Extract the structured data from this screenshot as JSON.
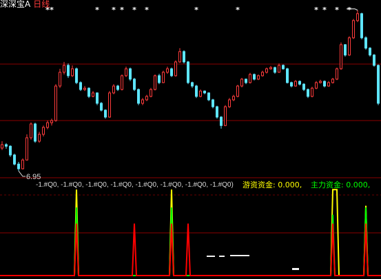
{
  "header": {
    "stock_name": "深深宝A",
    "period": "日线"
  },
  "price_panel": {
    "low_label": "6.95",
    "signal_marker": "*"
  },
  "indicator_panel": {
    "params_text": "-1.#Q0, -1.#Q0, -1.#Q0, -1.#Q0, -1.#Q0, -1.#Q0, -1.#Q0, -1.#Q0)",
    "hot_money_label": "游资资金: 0.000,",
    "main_force_label": "主力资金: 0.000,"
  },
  "colors": {
    "background": "#000000",
    "up_candle": "#ff3c3c",
    "down_candle": "#5ee6ff",
    "grid": "#8b0000",
    "marker": "#ffffff",
    "hot_money": "#ffff00",
    "main_force": "#00ff00",
    "third_series": "#ff0000"
  },
  "chart_data": [
    {
      "type": "bar",
      "mark": "candlestick",
      "title": "",
      "xlabel": "",
      "ylabel": "",
      "ylim": [
        6.91,
        12.12
      ],
      "grid": true,
      "ohlc": [
        [
          7.68,
          7.9,
          7.62,
          7.79
        ],
        [
          7.79,
          7.84,
          7.66,
          7.74
        ],
        [
          7.74,
          7.77,
          7.4,
          7.46
        ],
        [
          7.46,
          7.5,
          7.13,
          7.17
        ],
        [
          7.17,
          7.24,
          6.95,
          7.02
        ],
        [
          7.02,
          7.35,
          7.0,
          7.3
        ],
        [
          7.3,
          8.12,
          7.28,
          8.01
        ],
        [
          8.01,
          8.5,
          7.95,
          8.45
        ],
        [
          8.45,
          8.49,
          7.85,
          7.9
        ],
        [
          7.9,
          8.2,
          7.85,
          8.12
        ],
        [
          8.12,
          8.4,
          8.05,
          8.34
        ],
        [
          8.34,
          8.56,
          8.28,
          8.49
        ],
        [
          8.49,
          8.62,
          8.4,
          8.56
        ],
        [
          8.56,
          9.72,
          8.52,
          9.66
        ],
        [
          9.66,
          10.21,
          9.6,
          10.1
        ],
        [
          10.1,
          10.43,
          10.03,
          10.32
        ],
        [
          10.32,
          10.38,
          9.92,
          9.99
        ],
        [
          9.99,
          10.32,
          9.95,
          10.21
        ],
        [
          10.21,
          10.25,
          9.72,
          9.77
        ],
        [
          9.77,
          9.81,
          9.5,
          9.55
        ],
        [
          9.55,
          9.66,
          9.5,
          9.59
        ],
        [
          9.59,
          9.62,
          9.28,
          9.33
        ],
        [
          9.33,
          9.5,
          9.3,
          9.44
        ],
        [
          9.44,
          9.46,
          9.05,
          9.11
        ],
        [
          9.11,
          9.15,
          8.85,
          8.89
        ],
        [
          8.89,
          8.92,
          8.62,
          8.67
        ],
        [
          8.67,
          9.5,
          8.65,
          9.44
        ],
        [
          9.44,
          9.72,
          9.4,
          9.66
        ],
        [
          9.66,
          9.7,
          9.5,
          9.55
        ],
        [
          9.55,
          10.03,
          9.52,
          9.99
        ],
        [
          9.99,
          10.28,
          9.95,
          10.21
        ],
        [
          10.21,
          10.25,
          9.82,
          9.88
        ],
        [
          9.88,
          9.92,
          9.5,
          9.55
        ],
        [
          9.55,
          9.58,
          9.05,
          9.11
        ],
        [
          9.11,
          9.28,
          9.05,
          9.22
        ],
        [
          9.22,
          9.38,
          9.18,
          9.33
        ],
        [
          9.33,
          9.6,
          9.3,
          9.55
        ],
        [
          9.55,
          10.03,
          9.52,
          9.99
        ],
        [
          9.99,
          10.05,
          9.72,
          9.77
        ],
        [
          9.77,
          10.15,
          9.75,
          10.1
        ],
        [
          10.1,
          10.28,
          10.05,
          10.21
        ],
        [
          10.21,
          10.25,
          9.95,
          9.99
        ],
        [
          9.99,
          10.48,
          9.96,
          10.43
        ],
        [
          10.43,
          10.87,
          10.4,
          10.76
        ],
        [
          10.76,
          10.8,
          10.38,
          10.43
        ],
        [
          10.43,
          10.46,
          9.72,
          9.77
        ],
        [
          9.77,
          9.8,
          9.6,
          9.66
        ],
        [
          9.66,
          9.7,
          9.28,
          9.33
        ],
        [
          9.33,
          9.55,
          9.3,
          9.5
        ],
        [
          9.5,
          9.52,
          9.4,
          9.44
        ],
        [
          9.44,
          9.46,
          9.18,
          9.22
        ],
        [
          9.22,
          9.25,
          8.95,
          9.0
        ],
        [
          9.0,
          9.03,
          8.62,
          8.67
        ],
        [
          8.67,
          8.7,
          8.3,
          8.4
        ],
        [
          8.4,
          9.05,
          8.38,
          9.0
        ],
        [
          9.0,
          9.28,
          8.96,
          9.22
        ],
        [
          9.22,
          9.38,
          9.18,
          9.33
        ],
        [
          9.33,
          9.7,
          9.3,
          9.66
        ],
        [
          9.66,
          9.92,
          9.62,
          9.88
        ],
        [
          9.88,
          9.9,
          9.72,
          9.77
        ],
        [
          9.77,
          10.08,
          9.74,
          10.03
        ],
        [
          10.03,
          10.06,
          9.84,
          9.88
        ],
        [
          9.88,
          10.03,
          9.85,
          9.99
        ],
        [
          9.99,
          10.15,
          9.96,
          10.1
        ],
        [
          10.1,
          10.25,
          10.06,
          10.21
        ],
        [
          10.21,
          10.3,
          10.18,
          10.25
        ],
        [
          10.25,
          10.28,
          10.05,
          10.1
        ],
        [
          10.1,
          10.38,
          10.08,
          10.32
        ],
        [
          10.32,
          10.35,
          10.18,
          10.21
        ],
        [
          10.21,
          10.24,
          9.74,
          9.77
        ],
        [
          9.77,
          9.8,
          9.62,
          9.66
        ],
        [
          9.66,
          9.85,
          9.64,
          9.81
        ],
        [
          9.81,
          9.84,
          9.68,
          9.72
        ],
        [
          9.72,
          9.75,
          9.5,
          9.55
        ],
        [
          9.55,
          9.58,
          9.28,
          9.33
        ],
        [
          9.33,
          9.64,
          9.3,
          9.59
        ],
        [
          9.59,
          9.82,
          9.56,
          9.77
        ],
        [
          9.77,
          9.86,
          9.74,
          9.81
        ],
        [
          9.81,
          9.84,
          9.62,
          9.66
        ],
        [
          9.66,
          9.82,
          9.64,
          9.77
        ],
        [
          9.77,
          9.92,
          9.74,
          9.88
        ],
        [
          9.88,
          10.25,
          9.85,
          10.21
        ],
        [
          10.21,
          11.05,
          10.18,
          10.98
        ],
        [
          10.98,
          11.0,
          10.6,
          10.65
        ],
        [
          10.65,
          11.25,
          10.62,
          11.2
        ],
        [
          11.2,
          11.8,
          11.16,
          11.75
        ],
        [
          11.75,
          12.08,
          11.7,
          11.97
        ],
        [
          11.97,
          12.0,
          11.15,
          11.2
        ],
        [
          11.2,
          11.25,
          10.82,
          10.87
        ],
        [
          10.87,
          10.9,
          10.6,
          10.65
        ],
        [
          10.65,
          10.68,
          10.28,
          10.32
        ],
        [
          10.32,
          10.35,
          9.05,
          9.11
        ]
      ],
      "signal_bars": [
        11,
        12,
        23,
        27,
        29,
        32,
        35,
        47,
        57,
        76,
        78,
        81,
        84
      ]
    },
    {
      "type": "line",
      "title": "",
      "ylim": [
        0,
        5
      ],
      "grid": true,
      "series": [
        {
          "name": "游资资金",
          "color": "#ffff00",
          "values": [
            0,
            0,
            0,
            0,
            0,
            0,
            0,
            0,
            0,
            0,
            0,
            0,
            0,
            0,
            0,
            0,
            0,
            0,
            4.8,
            0,
            0,
            0,
            0,
            0,
            0,
            0,
            0,
            0,
            0,
            0,
            0,
            0,
            0,
            0,
            0,
            0,
            0,
            0,
            0,
            0,
            0,
            4.8,
            0,
            0,
            0,
            0,
            0,
            0,
            0,
            0,
            0,
            0,
            0,
            0,
            0,
            0,
            0,
            0,
            0,
            0,
            0,
            0,
            0,
            0,
            0,
            0,
            0,
            0,
            0,
            0,
            0,
            0,
            0,
            0,
            0,
            0,
            0,
            0,
            0,
            0,
            4.8,
            4.8,
            0,
            0,
            0,
            0,
            0,
            0,
            3.9,
            0,
            0,
            0
          ]
        },
        {
          "name": "主力资金",
          "color": "#00ff00",
          "values": [
            0,
            0,
            0,
            0,
            0,
            0,
            0,
            0,
            0,
            0,
            0,
            0,
            0,
            0,
            0,
            0,
            0,
            0,
            3.8,
            0,
            0,
            0,
            0,
            0,
            0,
            0,
            0,
            0,
            0,
            0,
            0,
            0,
            0,
            0,
            0,
            0,
            0,
            0,
            0,
            0,
            0,
            3.8,
            0,
            0,
            0,
            0,
            0,
            0,
            0,
            0,
            0,
            0,
            0,
            0,
            0,
            0,
            0,
            0,
            0,
            0,
            0,
            0,
            0,
            0,
            0,
            0,
            0,
            0,
            0,
            0,
            0,
            0,
            0,
            0,
            0,
            0,
            0,
            0,
            0,
            0,
            3.4,
            0,
            0,
            0,
            0,
            0,
            0,
            0,
            3.8,
            0,
            0,
            0
          ]
        },
        {
          "color": "#ff0000",
          "values": [
            0,
            0,
            0,
            0,
            0,
            0,
            0,
            0,
            0,
            0,
            0,
            0,
            0,
            0,
            0,
            0,
            0,
            0,
            2.9,
            0,
            0,
            0,
            0,
            0,
            0,
            0,
            0,
            0,
            0,
            0,
            0,
            0,
            2.9,
            0,
            0,
            0,
            0,
            0,
            0,
            0,
            0,
            2.9,
            0,
            0,
            0,
            2.9,
            0,
            0,
            0,
            0,
            0,
            0,
            0,
            0,
            0,
            0,
            0,
            0,
            0,
            0,
            0,
            0,
            0,
            0,
            0,
            0,
            0,
            0,
            0,
            0,
            0,
            0,
            0,
            0,
            0,
            0,
            0,
            0,
            0,
            0,
            2.9,
            0,
            0,
            0,
            0,
            0,
            0,
            0,
            2.9,
            0,
            0,
            0
          ]
        }
      ]
    }
  ]
}
